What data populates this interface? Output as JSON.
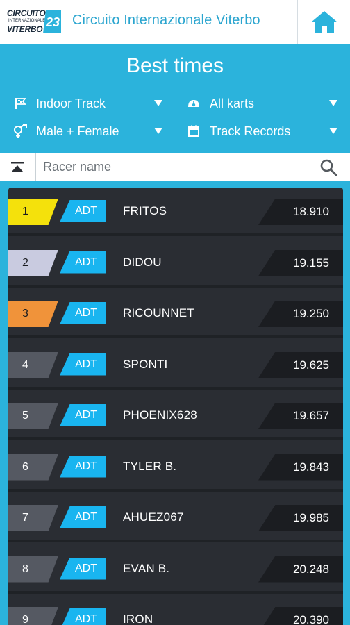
{
  "app": {
    "logo": {
      "line1": "CIRCUITO",
      "line2": "INTERNAZIONALE",
      "line3": "VITERBO",
      "mark": "23"
    },
    "title": "Circuito Internazionale Viterbo",
    "home_icon": "home-icon"
  },
  "header": {
    "title": "Best times",
    "filters": [
      {
        "label": "Indoor Track",
        "icon": "flag-icon"
      },
      {
        "label": "All karts",
        "icon": "kart-icon"
      },
      {
        "label": "Male + Female",
        "icon": "gender-icon"
      },
      {
        "label": "Track Records",
        "icon": "calendar-icon"
      }
    ]
  },
  "search": {
    "placeholder": "Racer name",
    "value": "",
    "collapse_icon": "collapse-up-icon",
    "search_icon": "search-icon"
  },
  "colors": {
    "accent": "#2bb3dc",
    "class_badge": "#19b5f0",
    "gold": "#f4e10c",
    "silver": "#c9cbe0",
    "bronze": "#f0933a",
    "default_pos": "#555962"
  },
  "results": [
    {
      "position": "1",
      "kart_class": "ADT",
      "racer": "FRITOS",
      "time": "18.910"
    },
    {
      "position": "2",
      "kart_class": "ADT",
      "racer": "DIDOU",
      "time": "19.155"
    },
    {
      "position": "3",
      "kart_class": "ADT",
      "racer": "RICOUNNET",
      "time": "19.250"
    },
    {
      "position": "4",
      "kart_class": "ADT",
      "racer": "SPONTI",
      "time": "19.625"
    },
    {
      "position": "5",
      "kart_class": "ADT",
      "racer": "PHOENIX628",
      "time": "19.657"
    },
    {
      "position": "6",
      "kart_class": "ADT",
      "racer": "TYLER B.",
      "time": "19.843"
    },
    {
      "position": "7",
      "kart_class": "ADT",
      "racer": "AHUEZ067",
      "time": "19.985"
    },
    {
      "position": "8",
      "kart_class": "ADT",
      "racer": "EVAN B.",
      "time": "20.248"
    },
    {
      "position": "9",
      "kart_class": "ADT",
      "racer": "IRON",
      "time": "20.390"
    }
  ]
}
